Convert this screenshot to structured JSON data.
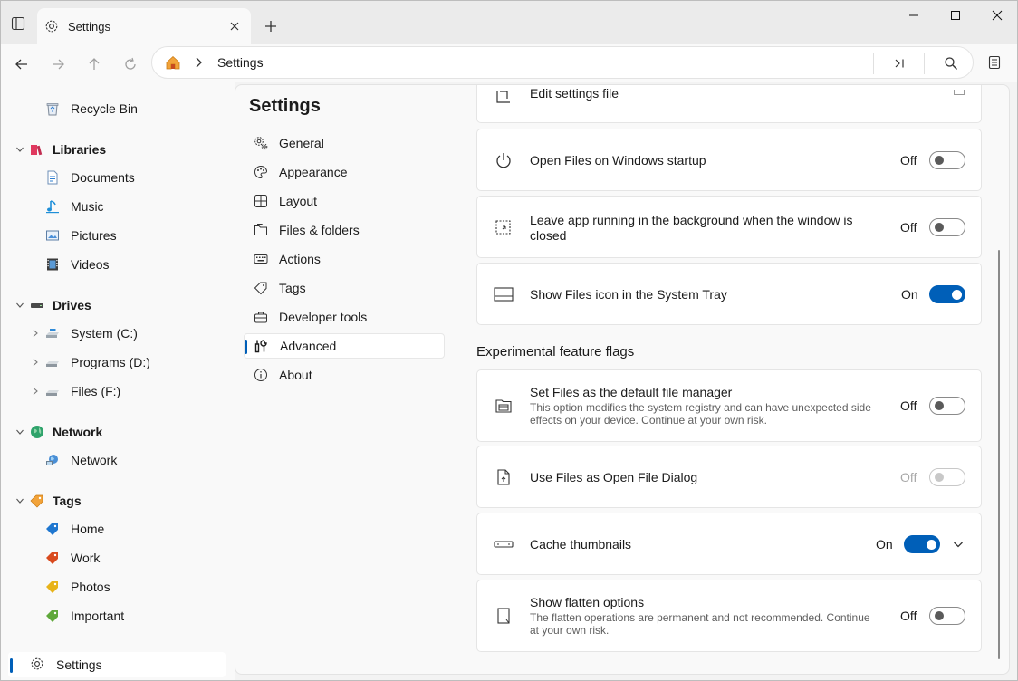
{
  "tab": {
    "label": "Settings"
  },
  "address": {
    "path": "Settings"
  },
  "leftnav": {
    "items": [
      {
        "label": "Recycle Bin"
      },
      {
        "label": "Libraries"
      },
      {
        "label": "Documents"
      },
      {
        "label": "Music"
      },
      {
        "label": "Pictures"
      },
      {
        "label": "Videos"
      },
      {
        "label": "Drives"
      },
      {
        "label": "System (C:)"
      },
      {
        "label": "Programs (D:)"
      },
      {
        "label": "Files (F:)"
      },
      {
        "label": "Network"
      },
      {
        "label": "Network"
      },
      {
        "label": "Tags"
      },
      {
        "label": "Home"
      },
      {
        "label": "Work"
      },
      {
        "label": "Photos"
      },
      {
        "label": "Important"
      }
    ],
    "settings_label": "Settings",
    "tag_colors": [
      "#1f77d0",
      "#d94a1e",
      "#e8b31a",
      "#5fa83a"
    ]
  },
  "settings": {
    "title": "Settings",
    "menu": [
      {
        "label": "General",
        "icon": "gear-icon"
      },
      {
        "label": "Appearance",
        "icon": "palette-icon"
      },
      {
        "label": "Layout",
        "icon": "layout-icon"
      },
      {
        "label": "Files & folders",
        "icon": "folder-icon"
      },
      {
        "label": "Actions",
        "icon": "keyboard-icon"
      },
      {
        "label": "Tags",
        "icon": "tag-icon"
      },
      {
        "label": "Developer tools",
        "icon": "toolbox-icon"
      },
      {
        "label": "Advanced",
        "icon": "wrench-icon",
        "selected": true
      },
      {
        "label": "About",
        "icon": "info-icon"
      }
    ],
    "cards": [
      {
        "title": "Edit settings file"
      },
      {
        "title": "Open Files on Windows startup",
        "state": "Off"
      },
      {
        "title": "Leave app running in the background when the window is closed",
        "state": "Off"
      },
      {
        "title": "Show Files icon in the System Tray",
        "state": "On"
      }
    ],
    "experimental_header": "Experimental feature flags",
    "experimental": [
      {
        "title": "Set Files as the default file manager",
        "desc": "This option modifies the system registry and can have unexpected side effects on your device. Continue at your own risk.",
        "state": "Off"
      },
      {
        "title": "Use Files as Open File Dialog",
        "state": "Off",
        "disabled": true
      },
      {
        "title": "Cache thumbnails",
        "state": "On"
      },
      {
        "title": "Show flatten options",
        "desc": "The flatten operations are permanent and not recommended. Continue at your own risk.",
        "state": "Off"
      }
    ]
  },
  "colors": {
    "accent": "#005fb8",
    "home_icon": "#f2a33a",
    "libraries_icon": "#e0395f",
    "network_icon": "#2fa36b"
  }
}
